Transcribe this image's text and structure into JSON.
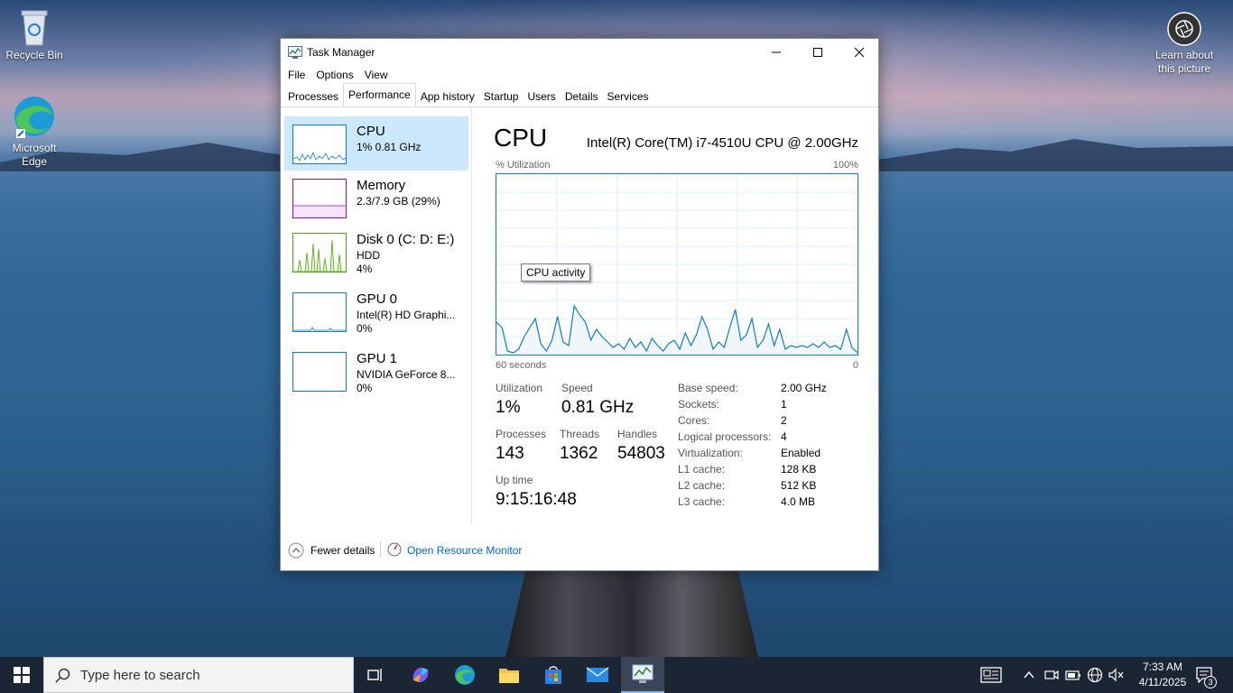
{
  "desktop": {
    "icons": [
      {
        "label": "Recycle Bin",
        "icon": "recycle-bin-icon"
      },
      {
        "label": "Microsoft Edge",
        "icon": "edge-icon"
      },
      {
        "label": "Learn about this picture",
        "icon": "camera-icon"
      }
    ]
  },
  "window": {
    "title": "Task Manager",
    "menu": [
      "File",
      "Options",
      "View"
    ],
    "tabs": [
      "Processes",
      "Performance",
      "App history",
      "Startup",
      "Users",
      "Details",
      "Services"
    ],
    "active_tab": "Performance"
  },
  "resources": [
    {
      "name": "CPU",
      "line1": "1% 0.81 GHz",
      "line2": "",
      "color": "#117dbb",
      "selected": true
    },
    {
      "name": "Memory",
      "line1": "2.3/7.9 GB (29%)",
      "line2": "",
      "color": "#8b12ae",
      "selected": false
    },
    {
      "name": "Disk 0 (C: D: E:)",
      "line1": "HDD",
      "line2": "4%",
      "color": "#4da60c",
      "selected": false
    },
    {
      "name": "GPU 0",
      "line1": "Intel(R) HD Graphi...",
      "line2": "0%",
      "color": "#117dbb",
      "selected": false
    },
    {
      "name": "GPU 1",
      "line1": "NVIDIA GeForce 8...",
      "line2": "0%",
      "color": "#117dbb",
      "selected": false
    }
  ],
  "cpu": {
    "title": "CPU",
    "model": "Intel(R) Core(TM) i7-4510U CPU @ 2.00GHz",
    "util_label": "% Utilization",
    "max_label": "100%",
    "time_label": "60 seconds",
    "zero_label": "0",
    "tooltip": "CPU activity",
    "utilization_label": "Utilization",
    "utilization": "1%",
    "speed_label": "Speed",
    "speed": "0.81 GHz",
    "processes_label": "Processes",
    "processes": "143",
    "threads_label": "Threads",
    "threads": "1362",
    "handles_label": "Handles",
    "handles": "54803",
    "uptime_label": "Up time",
    "uptime": "9:15:16:48",
    "specs": [
      {
        "k": "Base speed:",
        "v": "2.00 GHz"
      },
      {
        "k": "Sockets:",
        "v": "1"
      },
      {
        "k": "Cores:",
        "v": "2"
      },
      {
        "k": "Logical processors:",
        "v": "4"
      },
      {
        "k": "Virtualization:",
        "v": "Enabled"
      },
      {
        "k": "L1 cache:",
        "v": "128 KB"
      },
      {
        "k": "L2 cache:",
        "v": "512 KB"
      },
      {
        "k": "L3 cache:",
        "v": "4.0 MB"
      }
    ],
    "history": [
      18,
      15,
      2,
      1,
      3,
      10,
      15,
      20,
      6,
      2,
      8,
      21,
      7,
      5,
      27,
      22,
      18,
      8,
      14,
      10,
      7,
      4,
      6,
      3,
      9,
      4,
      7,
      2,
      9,
      5,
      2,
      6,
      8,
      3,
      12,
      5,
      11,
      21,
      14,
      3,
      7,
      4,
      15,
      25,
      8,
      11,
      20,
      4,
      8,
      17,
      5,
      14,
      3,
      5,
      4,
      5,
      4,
      6,
      4,
      7,
      4,
      5,
      3,
      14,
      4,
      1
    ]
  },
  "footer": {
    "fewer_details": "Fewer details",
    "open_resource_monitor": "Open Resource Monitor"
  },
  "taskbar": {
    "search_placeholder": "Type here to search",
    "time": "7:33 AM",
    "date": "4/11/2025",
    "notification_count": "3"
  }
}
